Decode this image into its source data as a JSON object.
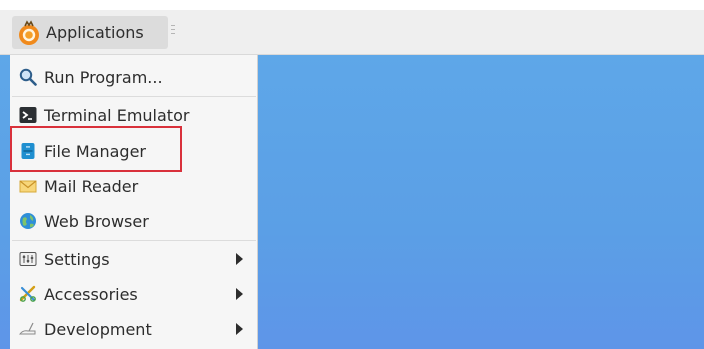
{
  "panel": {
    "applications_label": "Applications"
  },
  "menu": {
    "items": [
      {
        "label": "Run Program...",
        "icon": "search-icon"
      },
      {
        "label": "Terminal Emulator",
        "icon": "terminal-icon"
      },
      {
        "label": "File Manager",
        "icon": "file-manager-icon"
      },
      {
        "label": "Mail Reader",
        "icon": "mail-icon"
      },
      {
        "label": "Web Browser",
        "icon": "globe-icon"
      },
      {
        "label": "Settings",
        "icon": "settings-icon",
        "submenu": true
      },
      {
        "label": "Accessories",
        "icon": "accessories-icon",
        "submenu": true
      },
      {
        "label": "Development",
        "icon": "development-icon",
        "submenu": true
      }
    ]
  },
  "colors": {
    "desktop": "#5ea7e8",
    "highlight_box": "#d9313b",
    "panel": "#efefef",
    "menu": "#f6f6f6"
  }
}
